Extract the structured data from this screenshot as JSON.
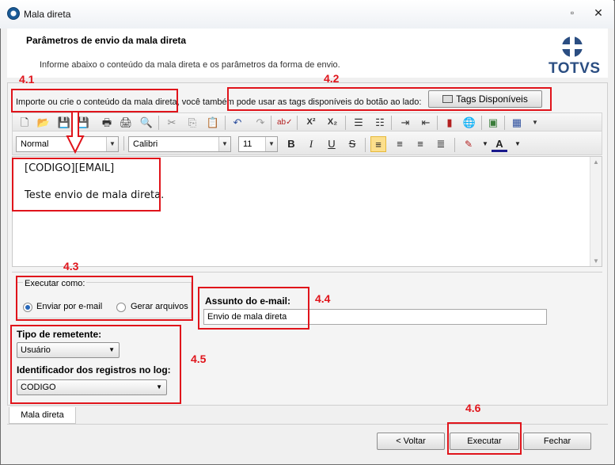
{
  "window": {
    "title": "Mala direta"
  },
  "header": {
    "title": "Parâmetros de envio da mala direta",
    "subtitle": "Informe abaixo o conteúdo da mala direta e os parâmetros da forma de envio.",
    "logo_text": "TOTVS"
  },
  "content": {
    "import_text": "Importe ou crie o conteúdo da mala direta, você também pode usar as tags disponíveis do botão ao lado:",
    "tags_button": "Tags Disponíveis"
  },
  "format_bar": {
    "style": "Normal",
    "font": "Calibri",
    "size": "11",
    "bold": "B",
    "italic": "I",
    "underline": "U",
    "strike": "S"
  },
  "editor": {
    "lines": [
      "[CODIGO][EMAIL]",
      "Teste envio de mala direta."
    ]
  },
  "execute_as": {
    "legend": "Executar como:",
    "options": [
      "Enviar por e-mail",
      "Gerar arquivos"
    ],
    "selected": "Enviar por e-mail"
  },
  "subject": {
    "label": "Assunto do e-mail:",
    "value": "Envio de mala direta"
  },
  "sender": {
    "label": "Tipo de remetente:",
    "value": "Usuário"
  },
  "log_id": {
    "label": "Identificador dos registros no log:",
    "value": "CODIGO"
  },
  "tab": {
    "label": "Mala direta"
  },
  "buttons": {
    "back": "< Voltar",
    "execute": "Executar",
    "close": "Fechar"
  },
  "annotations": {
    "labels": [
      "4.1",
      "4.2",
      "4.3",
      "4.4",
      "4.5",
      "4.6"
    ],
    "color": "#e0141b"
  },
  "icons": [
    "new-icon",
    "open-icon",
    "save-icon",
    "save-all-icon",
    "print-icon",
    "print-preview-icon",
    "find-icon",
    "cut-icon",
    "copy-icon",
    "paste-icon",
    "undo-icon",
    "redo-icon",
    "spellcheck-icon",
    "superscript-icon",
    "subscript-icon",
    "numbered-list-icon",
    "bullet-list-icon",
    "indent-icon",
    "outdent-icon",
    "bookmark-icon",
    "hyperlink-icon",
    "image-icon",
    "table-icon"
  ]
}
